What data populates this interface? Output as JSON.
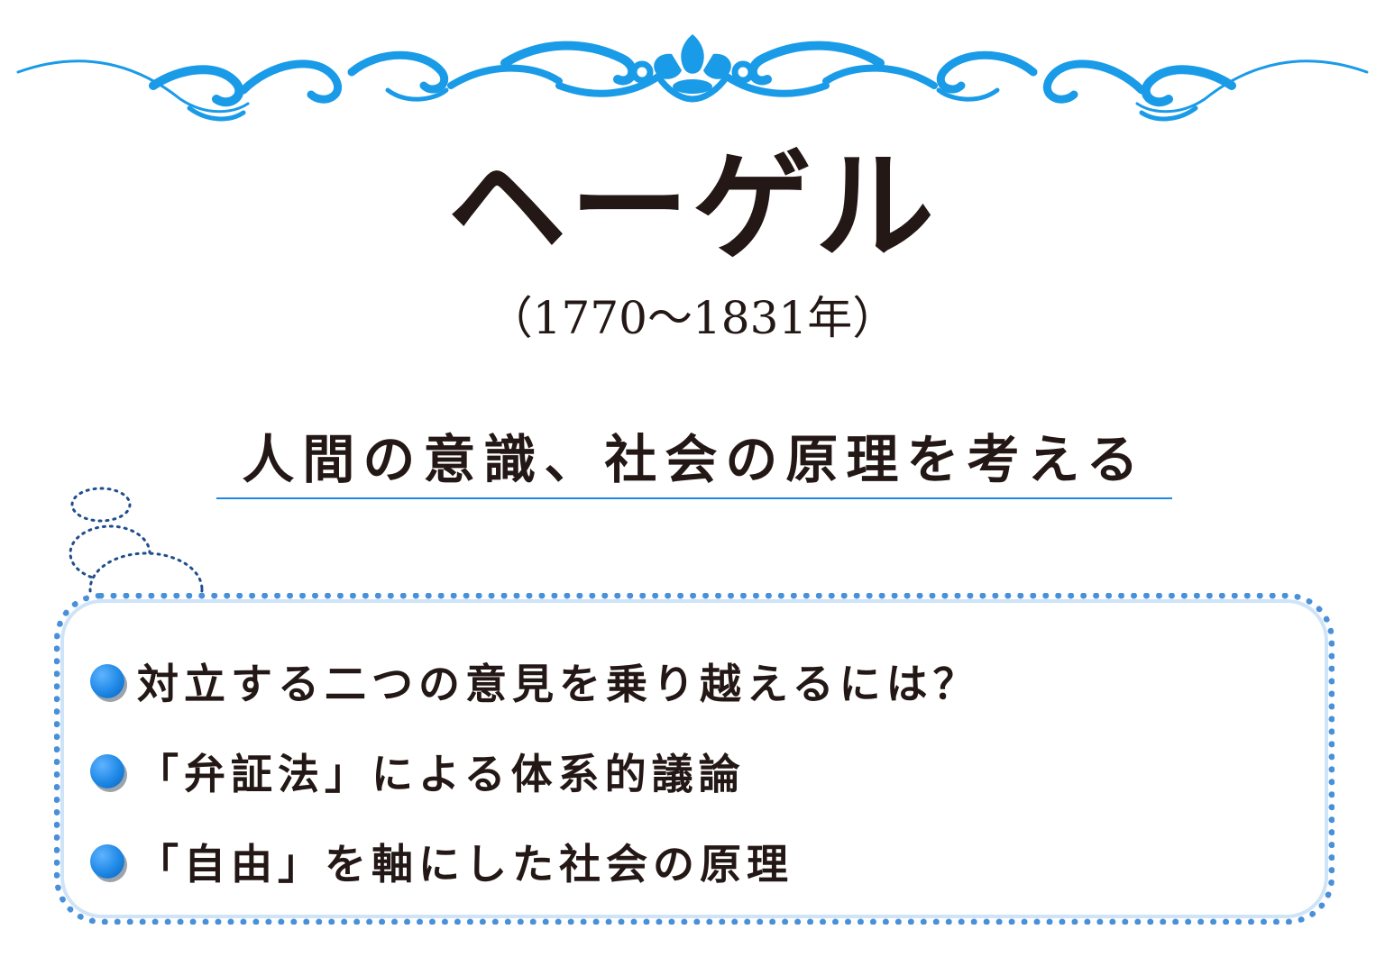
{
  "title": "ヘーゲル",
  "years": "（1770〜1831年）",
  "subtitle": "人間の意識、社会の原理を考える",
  "bullets": [
    "対立する二つの意見を乗り越えるには？",
    "「弁証法」による体系的議論",
    "「自由」を軸にした社会の原理"
  ],
  "colors": {
    "accent": "#1e88e5",
    "ornament": "#1a9be8",
    "text": "#231815",
    "dotted_border": "#4a90d9"
  },
  "icons": {
    "header": "ornamental-scroll-icon",
    "bullet": "blue-dot-icon",
    "decoration": "thought-bubble-icon"
  }
}
